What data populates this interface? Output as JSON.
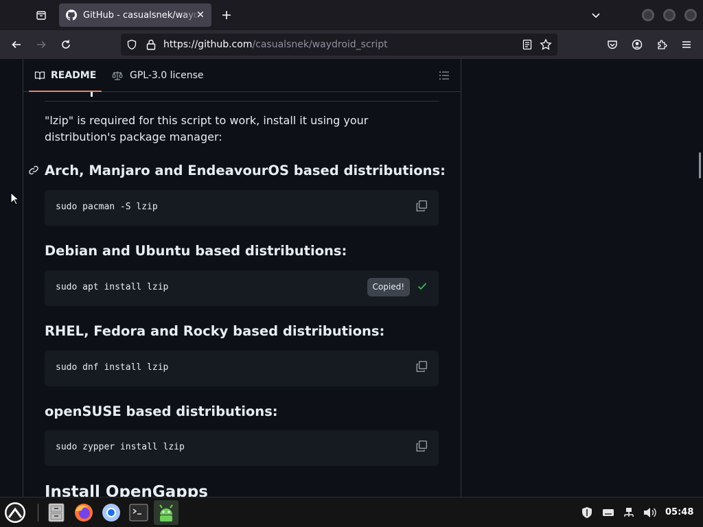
{
  "browser": {
    "tab_title": "GitHub - casualsnek/waydroid_script",
    "url_host": "https://github.com",
    "url_path": "/casualsnek/waydroid_script"
  },
  "readme": {
    "tab_readme": "README",
    "tab_license": "GPL-3.0 license",
    "intro": "\"lzip\" is required for this script to work, install it using your distribution's package manager:",
    "sections": [
      {
        "heading": "Arch, Manjaro and EndeavourOS based distributions:",
        "command": "sudo pacman -S lzip"
      },
      {
        "heading": "Debian and Ubuntu based distributions:",
        "command": "sudo apt install lzip"
      },
      {
        "heading": "RHEL, Fedora and Rocky based distributions:",
        "command": "sudo dnf install lzip"
      },
      {
        "heading": "openSUSE based distributions:",
        "command": "sudo zypper install lzip"
      }
    ],
    "next_heading": "Install OpenGapps",
    "copied_tooltip": "Copied!"
  },
  "taskbar": {
    "clock": "05:48",
    "apps": [
      "launcher",
      "file-manager",
      "firefox",
      "chromium",
      "terminal",
      "waydroid"
    ]
  },
  "colors": {
    "accent_underline": "#f78166",
    "page_bg": "#0d1117",
    "code_bg": "#161b22",
    "check_green": "#3fb950"
  }
}
